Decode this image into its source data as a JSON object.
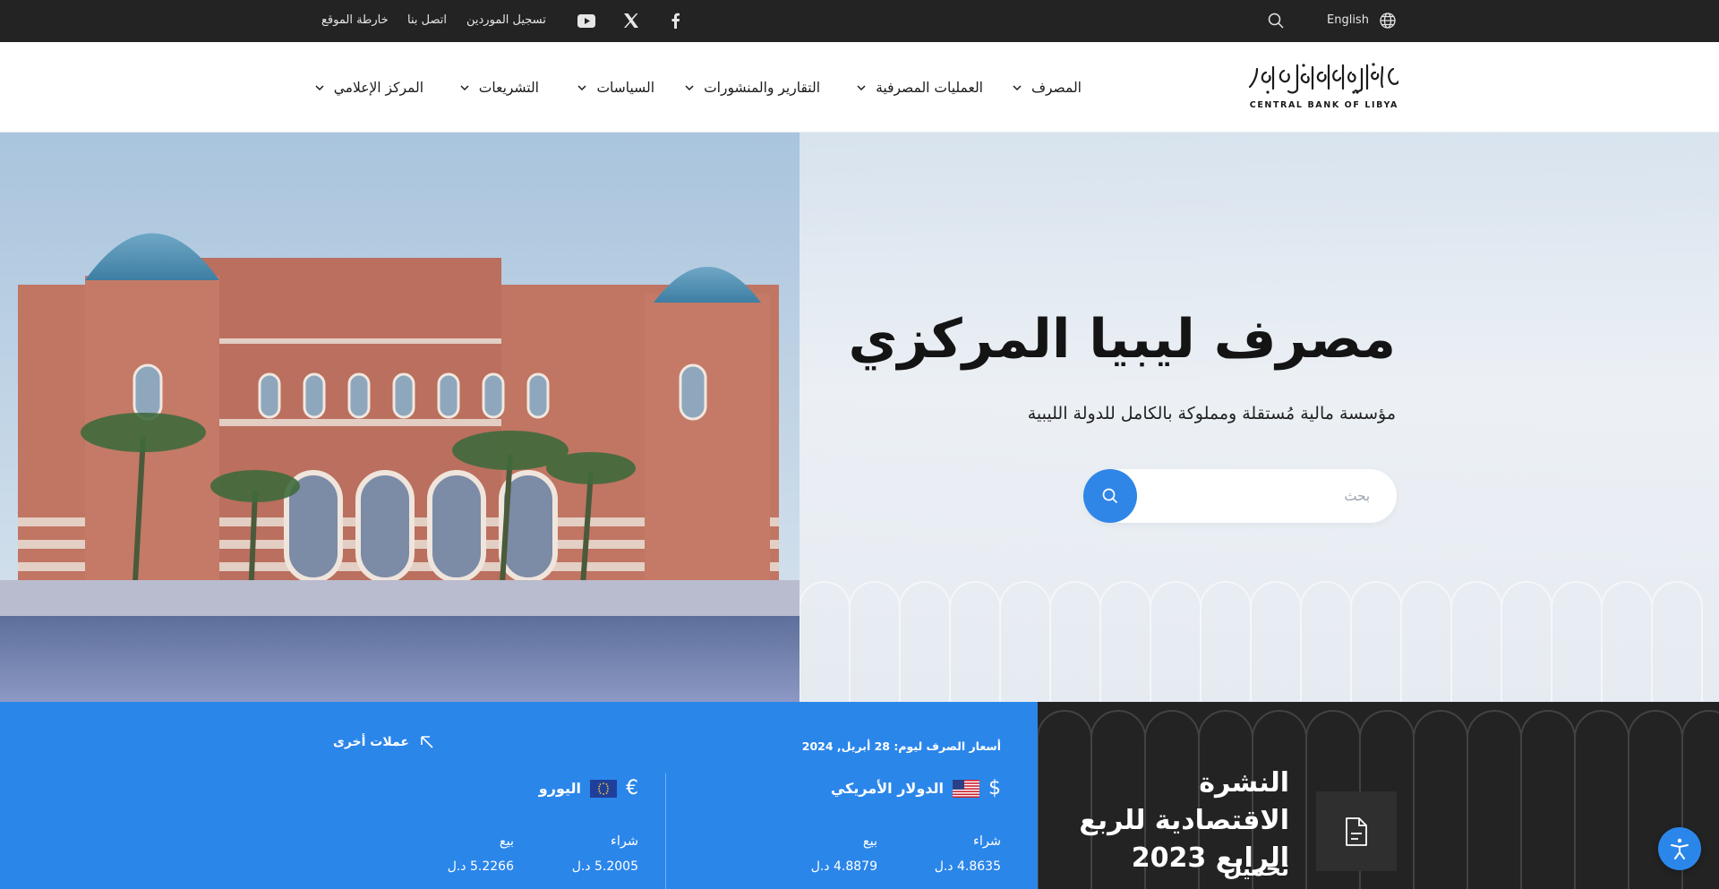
{
  "topbar": {
    "lang_label": "English",
    "sitemap": "خارطة الموقع",
    "contact": "اتصل بنا",
    "suppliers": "تسجيل الموردين",
    "icons": [
      "globe-icon",
      "search-icon",
      "facebook-icon",
      "x-twitter-icon",
      "youtube-icon"
    ]
  },
  "header": {
    "logo_ar": "مصرف ليبيا المركزي",
    "logo_en": "CENTRAL BANK OF LIBYA",
    "nav": [
      {
        "label": "المصرف"
      },
      {
        "label": "العمليات المصرفية"
      },
      {
        "label": "التقارير والمنشورات"
      },
      {
        "label": "السياسات"
      },
      {
        "label": "التشريعات"
      },
      {
        "label": "المركز الإعلامي"
      }
    ]
  },
  "hero": {
    "title": "مصرف ليبيا المركزي",
    "subtitle": "مؤسسة مالية مُستقلة ومملوكة بالكامل للدولة الليبية",
    "search_placeholder": "بحث"
  },
  "exchange": {
    "date_label": "أسعار الصرف ليوم:",
    "date_value": "28 أبريل, 2024",
    "other_label": "عملات أخرى",
    "currencies": [
      {
        "name": "الدولار الأمريكي",
        "symbol": "$",
        "flag": "us-flag",
        "buy_label": "شراء",
        "buy": "4.8635 د.ل",
        "sell_label": "بيع",
        "sell": "4.8879 د.ل"
      },
      {
        "name": "اليورو",
        "symbol": "€",
        "flag": "eu-flag",
        "buy_label": "شراء",
        "buy": "5.2005 د.ل",
        "sell_label": "بيع",
        "sell": "5.2266 د.ل"
      }
    ]
  },
  "bulletin": {
    "title": "النشرة الاقتصادية للربع الرابع 2023",
    "download_label": "تحميل"
  },
  "colors": {
    "accent_blue": "#2b86ea",
    "topbar_bg": "#232323",
    "bulletin_bg": "#232323"
  }
}
